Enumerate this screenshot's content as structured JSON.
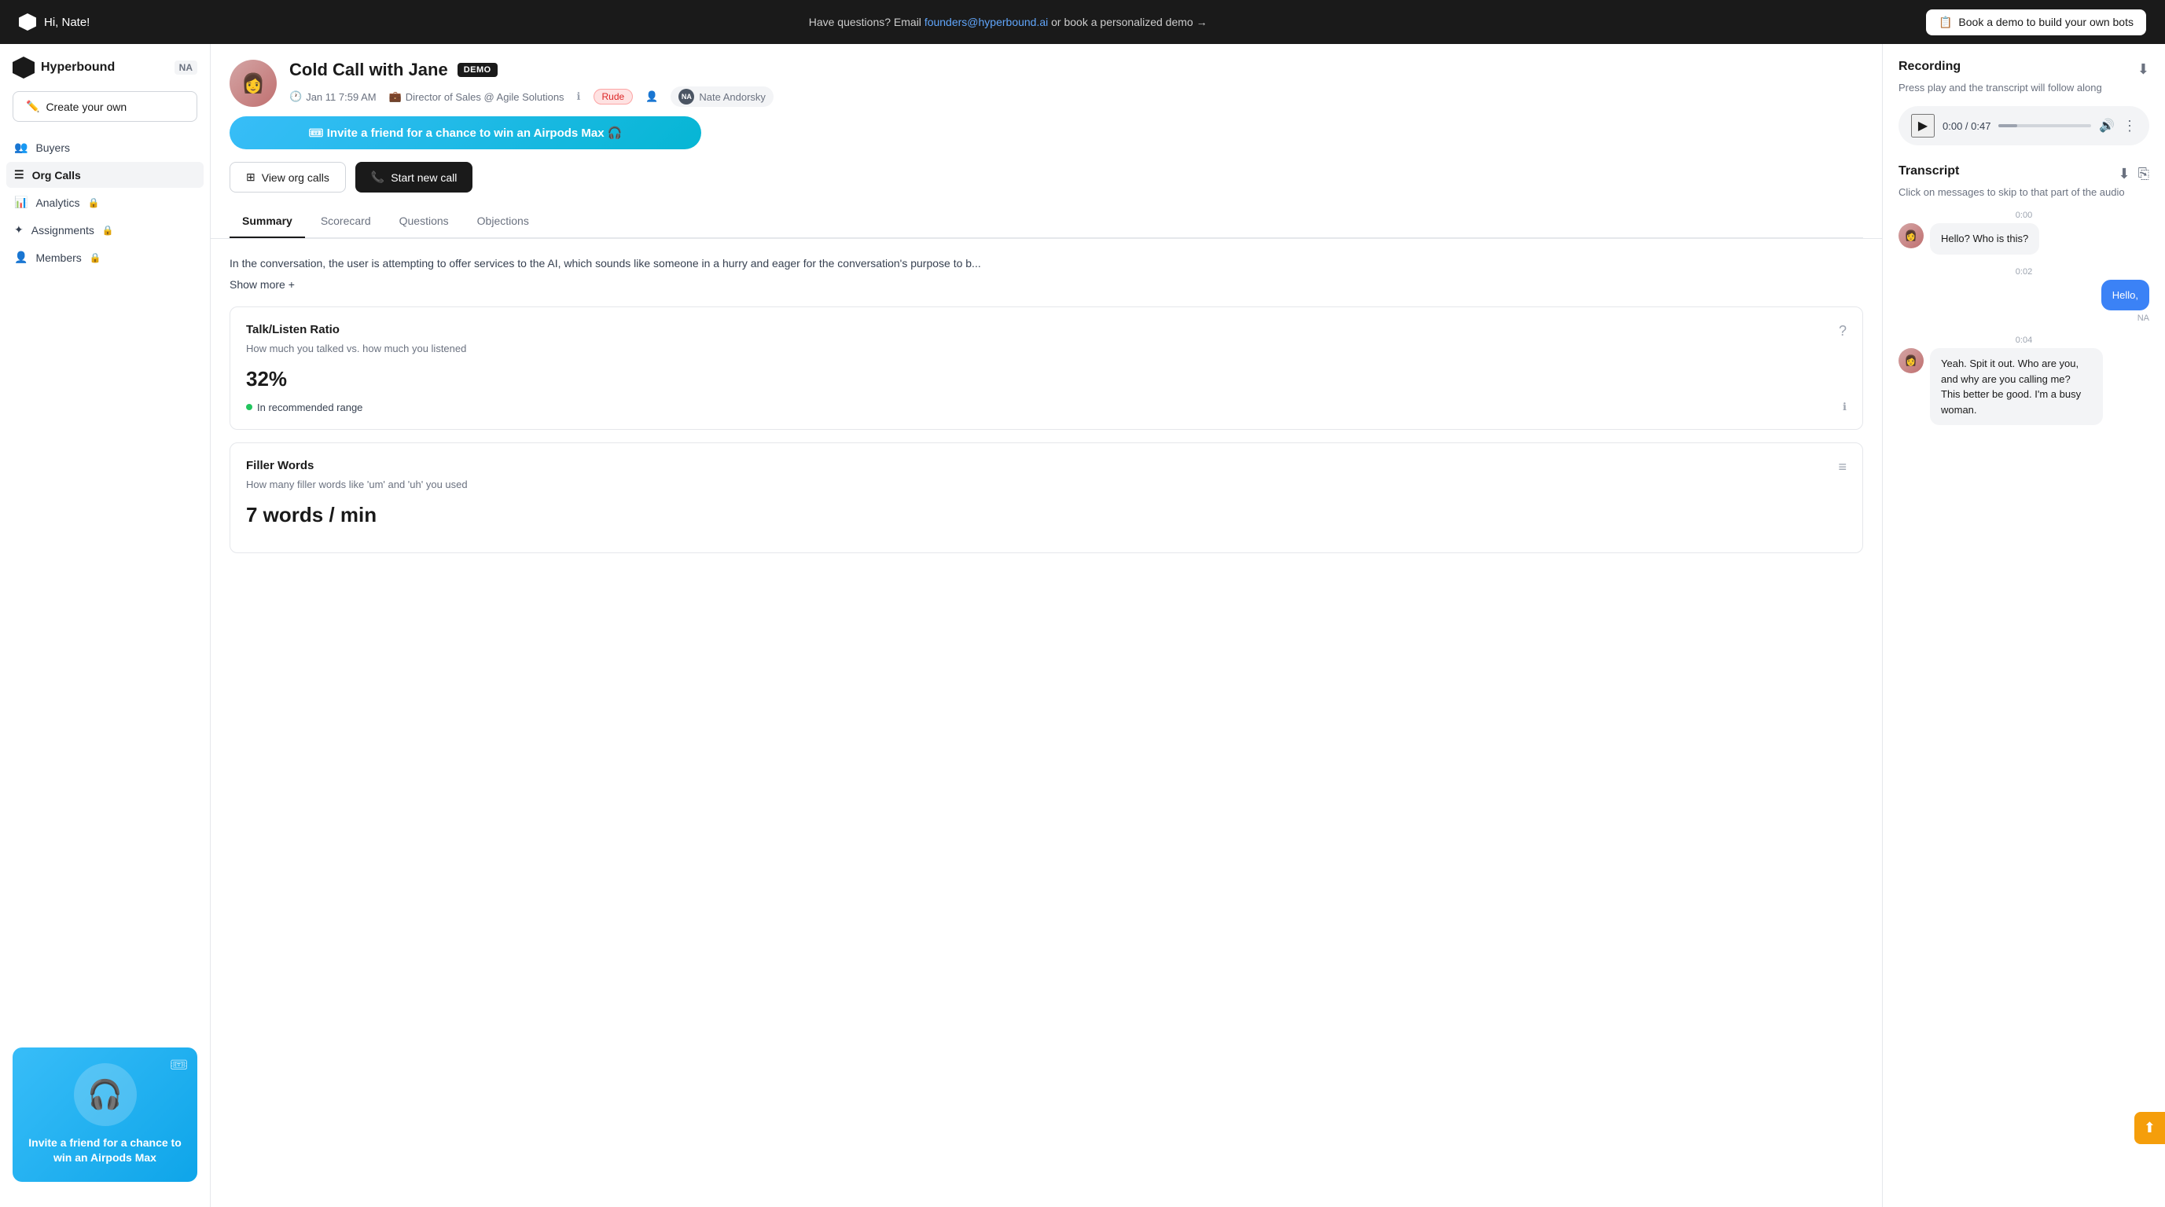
{
  "topbar": {
    "greeting": "Hi, Nate!",
    "question_text": "Have questions? Email ",
    "email": "founders@hyperbound.ai",
    "question_suffix": " or book a personalized demo →",
    "demo_btn": "Book a demo to build your own bots",
    "demo_icon": "📋"
  },
  "sidebar": {
    "brand": "Hyperbound",
    "badge": "NA",
    "create_btn": "Create your own",
    "nav_items": [
      {
        "id": "buyers",
        "label": "Buyers",
        "icon": "👥",
        "locked": false,
        "active": false
      },
      {
        "id": "org-calls",
        "label": "Org Calls",
        "icon": "≡",
        "locked": false,
        "active": true
      },
      {
        "id": "analytics",
        "label": "Analytics",
        "icon": "📊",
        "locked": true,
        "active": false
      },
      {
        "id": "assignments",
        "label": "Assignments",
        "icon": "✦",
        "locked": true,
        "active": false
      },
      {
        "id": "members",
        "label": "Members",
        "icon": "👤",
        "locked": true,
        "active": false
      }
    ],
    "promo": {
      "title": "Invite a friend for a chance to win an Airpods Max",
      "headphone_emoji": "🎧"
    }
  },
  "call": {
    "name": "Cold Call with Jane",
    "badge": "DEMO",
    "date": "Jan 11 7:59 AM",
    "role": "Director of Sales",
    "company": "Agile Solutions",
    "persona": "Rude",
    "user_initials": "NA",
    "user_name": "Nate Andorsky",
    "invite_banner": "🎟 Invite a friend for a chance to win an Airpods Max 🎧",
    "view_org_calls": "View org calls",
    "start_new_call": "Start new call",
    "tabs": [
      {
        "id": "summary",
        "label": "Summary",
        "active": true
      },
      {
        "id": "scorecard",
        "label": "Scorecard",
        "active": false
      },
      {
        "id": "questions",
        "label": "Questions",
        "active": false
      },
      {
        "id": "objections",
        "label": "Objections",
        "active": false
      }
    ],
    "summary_text": "In the conversation, the user is attempting to offer services to the AI, which sounds like someone in a hurry and eager for the conversation's purpose to b...",
    "show_more": "Show more +",
    "metrics": [
      {
        "id": "talk-listen",
        "title": "Talk/Listen Ratio",
        "description": "How much you talked vs. how much you listened",
        "value": "32%",
        "status": "In recommended range",
        "status_type": "good"
      },
      {
        "id": "filler-words",
        "title": "Filler Words",
        "description": "How many filler words like 'um' and 'uh' you used",
        "value": "7 words / min",
        "status": "",
        "status_type": ""
      }
    ]
  },
  "recording": {
    "title": "Recording",
    "subtitle": "Press play and the transcript will follow along",
    "time_current": "0:00",
    "time_total": "0:47",
    "progress": 20
  },
  "transcript": {
    "title": "Transcript",
    "subtitle": "Click on messages to skip to that part of the audio",
    "messages": [
      {
        "time": "0:00",
        "sender": "jane",
        "text": "Hello? Who is this?",
        "direction": "left"
      },
      {
        "time": "0:02",
        "sender": "nate",
        "text": "Hello,",
        "direction": "right",
        "label": "NA"
      },
      {
        "time": "0:04",
        "sender": "jane",
        "text": "Yeah. Spit it out. Who are you, and why are you calling me? This better be good. I'm a busy woman.",
        "direction": "left"
      }
    ]
  }
}
